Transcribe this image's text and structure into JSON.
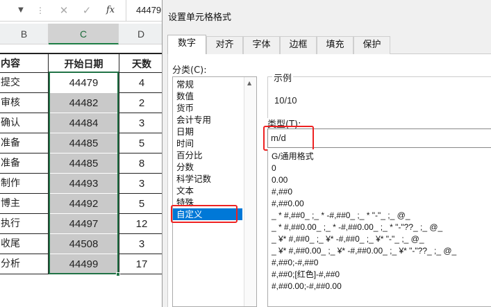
{
  "formula_bar": {
    "value": "44479",
    "fx": "fx",
    "cancel": "✕",
    "confirm": "✓",
    "arrow": "▼",
    "sep": "⋮"
  },
  "sheet": {
    "col_headers": [
      "B",
      "C",
      "D"
    ],
    "header_row": {
      "b": "内容",
      "c": "开始日期",
      "d": "天数"
    },
    "rows": [
      {
        "b": "提交",
        "c": "44479",
        "d": "4"
      },
      {
        "b": "审核",
        "c": "44482",
        "d": "2"
      },
      {
        "b": "确认",
        "c": "44484",
        "d": "3"
      },
      {
        "b": "准备",
        "c": "44485",
        "d": "5"
      },
      {
        "b": "准备",
        "c": "44485",
        "d": "8"
      },
      {
        "b": "制作",
        "c": "44493",
        "d": "3"
      },
      {
        "b": "博主",
        "c": "44492",
        "d": "5"
      },
      {
        "b": "执行",
        "c": "44497",
        "d": "12"
      },
      {
        "b": "收尾",
        "c": "44508",
        "d": "3"
      },
      {
        "b": "分析",
        "c": "44499",
        "d": "17"
      }
    ]
  },
  "dialog": {
    "title": "设置单元格格式",
    "tabs": [
      "数字",
      "对齐",
      "字体",
      "边框",
      "填充",
      "保护"
    ],
    "active_tab": "数字",
    "category_label": "分类(C):",
    "categories": [
      "常规",
      "数值",
      "货币",
      "会计专用",
      "日期",
      "时间",
      "百分比",
      "分数",
      "科学记数",
      "文本",
      "特殊",
      "自定义"
    ],
    "selected_category": "自定义",
    "sample_label": "示例",
    "sample_value": "10/10",
    "type_label": "类型(T):",
    "type_value": "m/d",
    "formats": [
      "G/通用格式",
      "0",
      "0.00",
      "#,##0",
      "#,##0.00",
      "_ * #,##0_ ;_ * -#,##0_ ;_ * \"-\"_ ;_ @_",
      "_ * #,##0.00_ ;_ * -#,##0.00_ ;_ * \"-\"??_ ;_ @_",
      "_ ¥* #,##0_ ;_ ¥* -#,##0_ ;_ ¥* \"-\"_ ;_ @_",
      "_ ¥* #,##0.00_ ;_ ¥* -#,##0.00_ ;_ ¥* \"-\"??_ ;_ @_",
      "#,##0;-#,##0",
      "#,##0;[红色]-#,##0",
      "#,##0.00;-#,##0.00"
    ]
  }
}
